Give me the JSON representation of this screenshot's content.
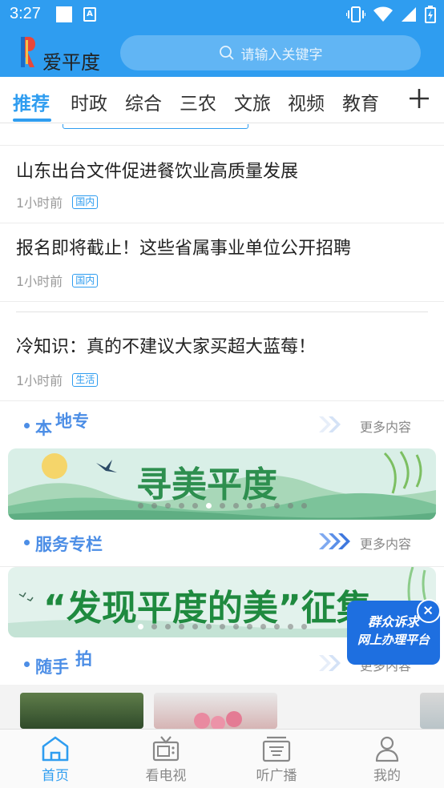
{
  "status_bar": {
    "time": "3:27"
  },
  "header": {
    "app_name": "爱平度",
    "search_placeholder": "请输入关键字"
  },
  "tabs": [
    {
      "label": "推荐",
      "active": true
    },
    {
      "label": "时政"
    },
    {
      "label": "综合"
    },
    {
      "label": "三农"
    },
    {
      "label": "文旅"
    },
    {
      "label": "视频"
    },
    {
      "label": "教育"
    }
  ],
  "news": [
    {
      "title": "山东出台文件促进餐饮业高质量发展",
      "time": "1小时前",
      "tag": "国内"
    },
    {
      "title": "报名即将截止！这些省属事业单位公开招聘",
      "time": "1小时前",
      "tag": "国内"
    },
    {
      "title": "冷知识：真的不建议大家买超大蓝莓！",
      "time": "1小时前",
      "tag": "生活"
    }
  ],
  "sections": {
    "local": {
      "title_a": "本",
      "title_b": "地专",
      "more": "更多内容"
    },
    "service": {
      "title": "服务专栏",
      "more": "更多内容"
    },
    "snap": {
      "title_a": "随手",
      "title_b": "拍",
      "more": "更多内容"
    }
  },
  "banners": {
    "local": {
      "text": "寻美平度"
    },
    "service": {
      "text": "“发现平度的美”征集"
    }
  },
  "float_badge": {
    "line1": "群众诉求",
    "line2": "网上办理平台"
  },
  "bottom_nav": [
    {
      "label": "首页",
      "icon": "home-icon",
      "active": true
    },
    {
      "label": "看电视",
      "icon": "tv-icon"
    },
    {
      "label": "听广播",
      "icon": "radio-icon"
    },
    {
      "label": "我的",
      "icon": "profile-icon"
    }
  ],
  "colors": {
    "brand": "#2f9df0",
    "section": "#4c8ee6"
  }
}
